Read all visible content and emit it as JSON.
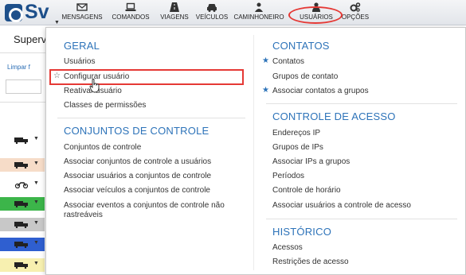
{
  "app": {
    "logo_text": "Sv"
  },
  "nav": [
    {
      "label": "MENSAGENS",
      "icon": "envelope-icon"
    },
    {
      "label": "COMANDOS",
      "icon": "laptop-icon"
    },
    {
      "label": "VIAGENS",
      "icon": "road-icon"
    },
    {
      "label": "VEÍCULOS",
      "icon": "car-icon"
    },
    {
      "label": "CAMINHONEIRO",
      "icon": "trucker-icon"
    },
    {
      "label": "USUÁRIOS",
      "icon": "user-icon"
    },
    {
      "label": "OPÇÕES",
      "icon": "gears-icon"
    }
  ],
  "background": {
    "page_title": "Superv",
    "limpar_link": "Limpar f"
  },
  "menu": {
    "geral": {
      "title": "GERAL",
      "items": [
        "Usuários",
        "Configurar usuário",
        "Reativar usuário",
        "Classes de permissões"
      ]
    },
    "conjuntos": {
      "title": "CONJUNTOS DE CONTROLE",
      "items": [
        "Conjuntos de controle",
        "Associar conjuntos de controle a usuários",
        "Associar usuários a conjuntos de controle",
        "Associar veículos a conjuntos de controle",
        "Associar eventos a conjuntos de controle não rastreáveis"
      ]
    },
    "contatos": {
      "title": "CONTATOS",
      "items": [
        "Contatos",
        "Grupos de contato",
        "Associar contatos a grupos"
      ]
    },
    "acesso": {
      "title": "CONTROLE DE ACESSO",
      "items": [
        "Endereços IP",
        "Grupos de IPs",
        "Associar IPs a grupos",
        "Períodos",
        "Controle de horário",
        "Associar usuários a controle de acesso"
      ]
    },
    "historico": {
      "title": "HISTÓRICO",
      "items": [
        "Acessos",
        "Restrições de acesso"
      ]
    }
  },
  "colors": {
    "accent": "#2d73b9",
    "highlight": "#e53935",
    "vehicle_rows": [
      "#ffffff",
      "#f6dcc8",
      "#ffffff",
      "#3cb54a",
      "#c8c8c8",
      "#2f5fd0",
      "#f7f0b0"
    ]
  }
}
